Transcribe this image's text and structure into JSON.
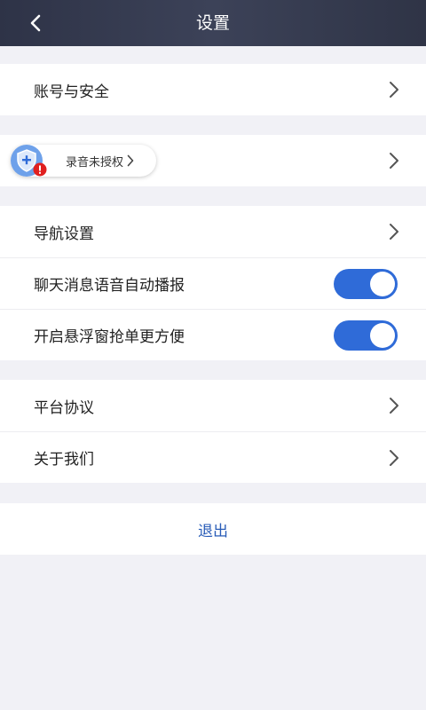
{
  "header": {
    "title": "设置",
    "back_icon": "chevron-left-icon",
    "background": "#363b50"
  },
  "account": {
    "label": "账号与安全"
  },
  "recording": {
    "badge_label": "录音未授权",
    "badge_icon": "shield-plus-warning-icon",
    "warning_color": "#e02020"
  },
  "settings": {
    "navigation_label": "导航设置",
    "chat_voice_label": "聊天消息语音自动播报",
    "chat_voice_on": true,
    "float_window_label": "开启悬浮窗抢单更方便",
    "float_window_on": true
  },
  "info": {
    "agreement_label": "平台协议",
    "about_label": "关于我们"
  },
  "logout": {
    "label": "退出",
    "color": "#2a5db8"
  },
  "colors": {
    "accent": "#2f6bd8",
    "background": "#f1f1f6"
  }
}
